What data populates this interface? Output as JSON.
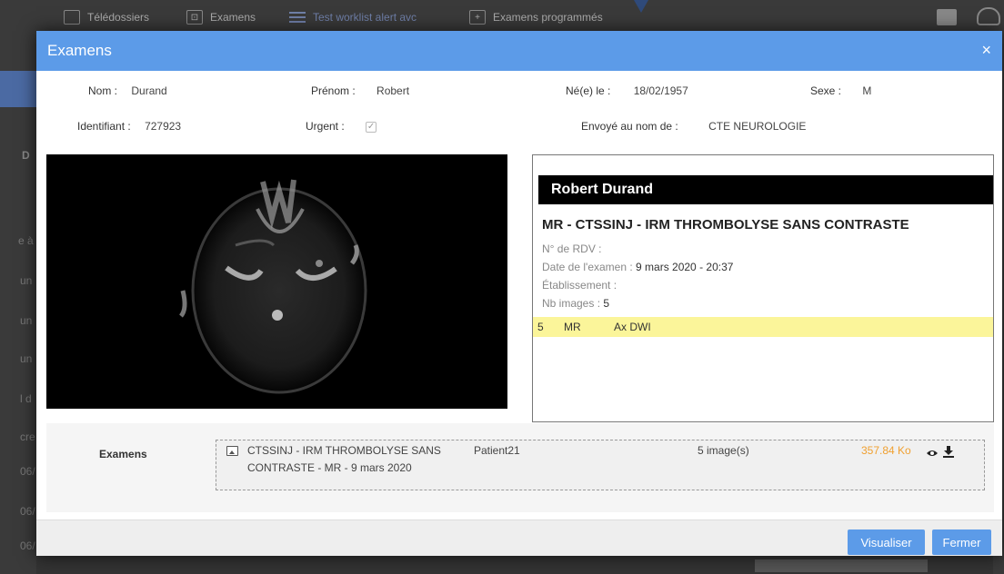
{
  "background": {
    "tabs": [
      {
        "label": "Télédossiers",
        "icon": "folder-icon"
      },
      {
        "label": "Examens",
        "icon": "image-icon"
      },
      {
        "label": "Test worklist alert avc",
        "icon": "list-icon"
      },
      {
        "label": "Examens programmés",
        "icon": "plus-icon"
      }
    ],
    "left_rows": [
      "D",
      "e à",
      "un",
      "un",
      "un",
      "l d",
      "cre",
      "06/",
      "06/",
      "06/"
    ]
  },
  "modal": {
    "title": "Examens",
    "close": "×",
    "patient": {
      "nom_label": "Nom :",
      "nom": "Durand",
      "prenom_label": "Prénom :",
      "prenom": "Robert",
      "ne_label": "Né(e) le :",
      "ne": "18/02/1957",
      "sexe_label": "Sexe :",
      "sexe": "M",
      "id_label": "Identifiant :",
      "id": "727923",
      "urgent_label": "Urgent :",
      "urgent_check": "✓",
      "envoye_label": "Envoyé au nom de :",
      "envoye": "CTE NEUROLOGIE"
    },
    "summary": {
      "name": "Robert Durand",
      "title": "MR - CTSSINJ - IRM THROMBOLYSE SANS CONTRASTE",
      "rdv_label": "N° de RDV :",
      "date_label": "Date de l'examen :",
      "date": "9 mars 2020 - 20:37",
      "etab_label": "Établissement :",
      "nb_label": "Nb images :",
      "nb": "5",
      "series": {
        "num": "5",
        "modality": "MR",
        "desc": "Ax DWI"
      }
    },
    "exams": {
      "label": "Examens",
      "item": {
        "title_line1": "CTSSINJ - IRM THROMBOLYSE SANS",
        "title_line2": "CONTRASTE - MR - 9 mars 2020",
        "patient": "Patient21",
        "images": "5 image(s)",
        "size": "357.84 Ko",
        "size_color": "#f0a030"
      }
    },
    "buttons": {
      "visualiser": "Visualiser",
      "fermer": "Fermer"
    },
    "accent": "#5c9be8"
  }
}
